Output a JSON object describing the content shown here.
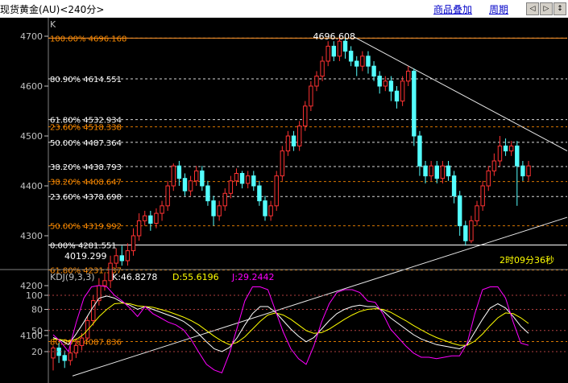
{
  "window": {
    "title": "现货黄金(AU)<240分>",
    "links": [
      "商品叠加",
      "周期"
    ],
    "nav_buttons": [
      "◁",
      "▷",
      "↕"
    ]
  },
  "main_panel": {
    "label": "K",
    "countdown": "2时09分36秒",
    "peak_label": "4696.608",
    "low_label": "4019.299",
    "fib_left_group": [
      {
        "label": "100.00% 4696.168",
        "value": 4696.168,
        "color": "#ff8c00"
      },
      {
        "label": "80.90% 4614.551",
        "value": 4614.551,
        "color": "#ffffff"
      },
      {
        "label": "61.80% 4532.934",
        "value": 4532.934,
        "color": "#ffffff"
      },
      {
        "label": "50.00% 4487.364",
        "value": 4487.364,
        "color": "#ffffff"
      },
      {
        "label": "38.20% 4438.793",
        "value": 4438.793,
        "color": "#ffffff"
      },
      {
        "label": "23.60% 4378.698",
        "value": 4378.698,
        "color": "#ffffff"
      },
      {
        "label": "0.00% 4281.551",
        "value": 4281.551,
        "color": "#ffffff"
      }
    ],
    "fib_orange_group": [
      {
        "label": "100.00% 4696.168",
        "value": 4696.168,
        "color": "#ff8c00"
      },
      {
        "label": "23.60% 4518.338",
        "value": 4518.338,
        "color": "#ff8c00"
      },
      {
        "label": "38.20% 4408.647",
        "value": 4408.647,
        "color": "#ff8c00"
      },
      {
        "label": "50.00% 4319.992",
        "value": 4319.992,
        "color": "#ff8c00"
      },
      {
        "label": "61.80% 4231.337",
        "value": 4231.337,
        "color": "#ff8c00"
      },
      {
        "label": "80.90% 4087.836",
        "value": 4087.836,
        "color": "#ff8c00"
      }
    ]
  },
  "kdj_panel": {
    "label": "KDJ(9,3,3)",
    "k_text": "K:46.8278",
    "d_text": "D:55.6196",
    "j_text": "J:29.2442",
    "colors": {
      "k": "#ffffff",
      "d": "#ffff00",
      "j": "#ff00ff"
    }
  },
  "chart_data": [
    {
      "type": "candlestick",
      "yticks": [
        4100,
        4200,
        4300,
        4400,
        4500,
        4600,
        4700
      ],
      "ylim": [
        4020,
        4720
      ],
      "candles": [
        [
          4055,
          4075,
          4030,
          4080
        ],
        [
          4075,
          4060,
          4045,
          4085
        ],
        [
          4060,
          4050,
          4035,
          4070
        ],
        [
          4050,
          4065,
          4040,
          4080
        ],
        [
          4065,
          4080,
          4055,
          4095
        ],
        [
          4080,
          4095,
          4070,
          4105
        ],
        [
          4095,
          4130,
          4090,
          4140
        ],
        [
          4130,
          4170,
          4120,
          4180
        ],
        [
          4170,
          4200,
          4160,
          4215
        ],
        [
          4200,
          4210,
          4190,
          4225
        ],
        [
          4210,
          4245,
          4195,
          4260
        ],
        [
          4245,
          4260,
          4235,
          4275
        ],
        [
          4260,
          4250,
          4240,
          4280
        ],
        [
          4250,
          4270,
          4240,
          4285
        ],
        [
          4270,
          4300,
          4260,
          4315
        ],
        [
          4300,
          4330,
          4290,
          4345
        ],
        [
          4330,
          4340,
          4320,
          4350
        ],
        [
          4340,
          4325,
          4310,
          4350
        ],
        [
          4325,
          4345,
          4315,
          4355
        ],
        [
          4345,
          4360,
          4330,
          4370
        ],
        [
          4360,
          4400,
          4350,
          4410
        ],
        [
          4400,
          4440,
          4390,
          4445
        ],
        [
          4440,
          4415,
          4400,
          4450
        ],
        [
          4415,
          4390,
          4380,
          4425
        ],
        [
          4390,
          4410,
          4380,
          4420
        ],
        [
          4410,
          4430,
          4400,
          4440
        ],
        [
          4430,
          4400,
          4390,
          4440
        ],
        [
          4400,
          4370,
          4360,
          4410
        ],
        [
          4370,
          4340,
          4320,
          4380
        ],
        [
          4340,
          4360,
          4330,
          4370
        ],
        [
          4360,
          4385,
          4350,
          4395
        ],
        [
          4385,
          4410,
          4375,
          4420
        ],
        [
          4410,
          4425,
          4400,
          4435
        ],
        [
          4425,
          4405,
          4395,
          4430
        ],
        [
          4405,
          4420,
          4395,
          4430
        ],
        [
          4420,
          4400,
          4390,
          4430
        ],
        [
          4400,
          4370,
          4360,
          4410
        ],
        [
          4370,
          4340,
          4330,
          4380
        ],
        [
          4340,
          4360,
          4330,
          4370
        ],
        [
          4360,
          4420,
          4350,
          4430
        ],
        [
          4420,
          4470,
          4410,
          4480
        ],
        [
          4470,
          4500,
          4460,
          4510
        ],
        [
          4500,
          4480,
          4470,
          4510
        ],
        [
          4480,
          4520,
          4470,
          4530
        ],
        [
          4520,
          4560,
          4510,
          4570
        ],
        [
          4560,
          4600,
          4550,
          4610
        ],
        [
          4600,
          4620,
          4590,
          4630
        ],
        [
          4620,
          4650,
          4610,
          4660
        ],
        [
          4650,
          4680,
          4640,
          4690
        ],
        [
          4680,
          4660,
          4650,
          4690
        ],
        [
          4660,
          4690,
          4650,
          4697
        ],
        [
          4690,
          4670,
          4655,
          4697
        ],
        [
          4670,
          4650,
          4640,
          4680
        ],
        [
          4650,
          4640,
          4620,
          4660
        ],
        [
          4640,
          4660,
          4630,
          4670
        ],
        [
          4660,
          4640,
          4625,
          4670
        ],
        [
          4640,
          4620,
          4610,
          4650
        ],
        [
          4620,
          4600,
          4585,
          4630
        ],
        [
          4600,
          4610,
          4590,
          4620
        ],
        [
          4610,
          4590,
          4570,
          4620
        ],
        [
          4590,
          4570,
          4555,
          4600
        ],
        [
          4570,
          4610,
          4560,
          4620
        ],
        [
          4610,
          4630,
          4600,
          4640
        ],
        [
          4630,
          4500,
          4480,
          4635
        ],
        [
          4500,
          4440,
          4420,
          4510
        ],
        [
          4440,
          4420,
          4405,
          4450
        ],
        [
          4420,
          4440,
          4410,
          4450
        ],
        [
          4440,
          4415,
          4405,
          4450
        ],
        [
          4415,
          4440,
          4405,
          4450
        ],
        [
          4440,
          4420,
          4410,
          4450
        ],
        [
          4420,
          4380,
          4365,
          4430
        ],
        [
          4380,
          4320,
          4300,
          4390
        ],
        [
          4320,
          4290,
          4280,
          4330
        ],
        [
          4290,
          4330,
          4285,
          4340
        ],
        [
          4330,
          4360,
          4320,
          4370
        ],
        [
          4360,
          4400,
          4350,
          4410
        ],
        [
          4400,
          4430,
          4390,
          4440
        ],
        [
          4430,
          4450,
          4420,
          4465
        ],
        [
          4450,
          4480,
          4440,
          4500
        ],
        [
          4480,
          4470,
          4460,
          4495
        ],
        [
          4470,
          4480,
          4460,
          4490
        ],
        [
          4480,
          4440,
          4360,
          4490
        ],
        [
          4440,
          4420,
          4410,
          4450
        ],
        [
          4420,
          4440,
          4410,
          4450
        ]
      ]
    },
    {
      "type": "line",
      "yticks": [
        20,
        50,
        80,
        100
      ],
      "ylim": [
        -5,
        115
      ],
      "series": [
        {
          "name": "K",
          "values": [
            40,
            36,
            30,
            45,
            62,
            80,
            96,
            99,
            96,
            90,
            86,
            80,
            84,
            80,
            76,
            72,
            68,
            63,
            55,
            45,
            34,
            24,
            20,
            26,
            40,
            58,
            74,
            84,
            84,
            76,
            64,
            52,
            42,
            34,
            40,
            52,
            64,
            74,
            80,
            84,
            86,
            84,
            84,
            78,
            68,
            60,
            52,
            44,
            38,
            34,
            30,
            28,
            26,
            24,
            30,
            48,
            66,
            82,
            88,
            82,
            70,
            56,
            46
          ]
        },
        {
          "name": "D",
          "values": [
            38,
            37,
            35,
            37,
            45,
            57,
            70,
            80,
            88,
            89,
            88,
            85,
            84,
            83,
            80,
            77,
            73,
            69,
            64,
            58,
            50,
            42,
            35,
            30,
            33,
            41,
            52,
            63,
            72,
            75,
            72,
            66,
            58,
            50,
            46,
            47,
            52,
            59,
            66,
            72,
            77,
            80,
            81,
            80,
            76,
            70,
            64,
            57,
            51,
            45,
            40,
            36,
            32,
            29,
            29,
            35,
            45,
            57,
            68,
            75,
            74,
            68,
            60
          ]
        },
        {
          "name": "J",
          "values": [
            44,
            34,
            20,
            61,
            96,
            112,
            114,
            112,
            100,
            92,
            82,
            70,
            84,
            74,
            68,
            62,
            58,
            51,
            37,
            19,
            2,
            -6,
            -10,
            18,
            54,
            92,
            112,
            112,
            108,
            78,
            48,
            24,
            10,
            2,
            28,
            62,
            88,
            104,
            108,
            108,
            104,
            92,
            90,
            74,
            52,
            40,
            28,
            18,
            12,
            12,
            10,
            12,
            14,
            14,
            32,
            74,
            108,
            112,
            112,
            96,
            62,
            32,
            29
          ]
        }
      ]
    }
  ]
}
